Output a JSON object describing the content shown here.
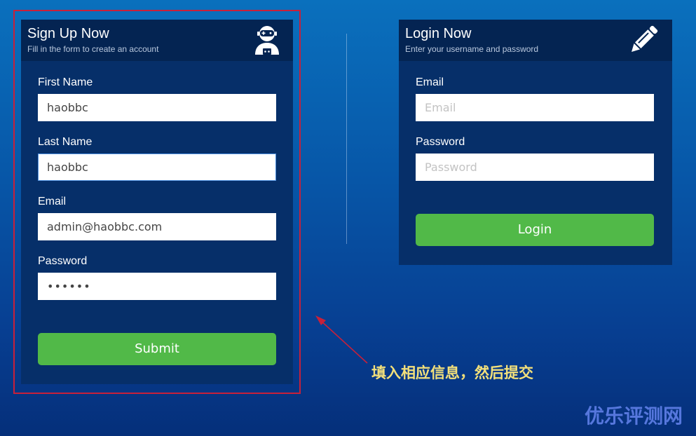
{
  "colors": {
    "card_bg": "#062f69",
    "card_header_bg": "#042452",
    "button_green": "#51b948",
    "highlight_red": "#c8203a",
    "annotation_yellow": "#f3e07a",
    "watermark_blue": "#5f7fe8"
  },
  "signup": {
    "title": "Sign Up Now",
    "subtitle": "Fill in the form to create an account",
    "icon": "astronaut-icon",
    "first_name": {
      "label": "First Name",
      "value": "haobbc"
    },
    "last_name": {
      "label": "Last Name",
      "value": "haobbc"
    },
    "email": {
      "label": "Email",
      "value": "admin@haobbc.com"
    },
    "password": {
      "label": "Password",
      "value": "••••••"
    },
    "submit_label": "Submit"
  },
  "login": {
    "title": "Login Now",
    "subtitle": "Enter your username and password",
    "icon": "pencil-icon",
    "email": {
      "label": "Email",
      "placeholder": "Email"
    },
    "password": {
      "label": "Password",
      "placeholder": "Password"
    },
    "login_label": "Login"
  },
  "annotation": {
    "text": "填入相应信息，然后提交"
  },
  "watermark": {
    "text": "优乐评测网"
  }
}
